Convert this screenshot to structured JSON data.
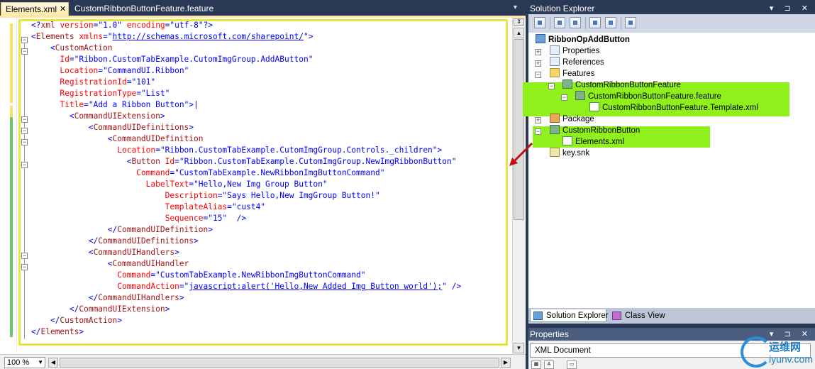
{
  "editor": {
    "tabs": [
      {
        "label": "Elements.xml",
        "close": "✕"
      },
      {
        "label": "CustomRibbonButtonFeature.feature"
      }
    ],
    "tab_menu": "▼",
    "zoom": "100 %",
    "code_lines": [
      [
        [
          "b",
          "<?"
        ],
        [
          "t",
          "xml"
        ],
        [
          "a",
          " version"
        ],
        [
          "b",
          "=\""
        ],
        [
          "v",
          "1.0"
        ],
        [
          "b",
          "\""
        ],
        [
          "a",
          " encoding"
        ],
        [
          "b",
          "=\""
        ],
        [
          "v",
          "utf-8"
        ],
        [
          "b",
          "\"?>"
        ]
      ],
      [
        [
          "b",
          "<"
        ],
        [
          "t",
          "Elements"
        ],
        [
          "a",
          " xmlns"
        ],
        [
          "b",
          "=\""
        ],
        [
          "u",
          "http://schemas.microsoft.com/sharepoint/"
        ],
        [
          "b",
          "\">"
        ]
      ],
      [
        [
          "b",
          "    <"
        ],
        [
          "t",
          "CustomAction"
        ]
      ],
      [
        [
          "a",
          "      Id"
        ],
        [
          "b",
          "=\""
        ],
        [
          "v",
          "Ribbon.CustomTabExample.CutomImgGroup.AddAButton"
        ],
        [
          "b",
          "\""
        ]
      ],
      [
        [
          "a",
          "      Location"
        ],
        [
          "b",
          "=\""
        ],
        [
          "v",
          "CommandUI.Ribbon"
        ],
        [
          "b",
          "\""
        ]
      ],
      [
        [
          "a",
          "      RegistrationId"
        ],
        [
          "b",
          "=\""
        ],
        [
          "v",
          "101"
        ],
        [
          "b",
          "\""
        ]
      ],
      [
        [
          "a",
          "      RegistrationType"
        ],
        [
          "b",
          "=\""
        ],
        [
          "v",
          "List"
        ],
        [
          "b",
          "\""
        ]
      ],
      [
        [
          "a",
          "      Title"
        ],
        [
          "b",
          "=\""
        ],
        [
          "v",
          "Add a Ribbon Button"
        ],
        [
          "b",
          "\">|"
        ]
      ],
      [
        [
          "b",
          "        <"
        ],
        [
          "t",
          "CommandUIExtension"
        ],
        [
          "b",
          ">"
        ]
      ],
      [
        [
          "b",
          "            <"
        ],
        [
          "t",
          "CommandUIDefinitions"
        ],
        [
          "b",
          ">"
        ]
      ],
      [
        [
          "b",
          "                <"
        ],
        [
          "t",
          "CommandUIDefinition"
        ]
      ],
      [
        [
          "a",
          "                  Location"
        ],
        [
          "b",
          "=\""
        ],
        [
          "v",
          "Ribbon.CustomTabExample.CutomImgGroup.Controls._children"
        ],
        [
          "b",
          "\">"
        ]
      ],
      [
        [
          "b",
          "                    <"
        ],
        [
          "t",
          "Button"
        ],
        [
          "a",
          " Id"
        ],
        [
          "b",
          "=\""
        ],
        [
          "v",
          "Ribbon.CustomTabExample.CutomImgGroup.NewImgRibbonButton"
        ],
        [
          "b",
          "\""
        ]
      ],
      [
        [
          "a",
          "                      Command"
        ],
        [
          "b",
          "=\""
        ],
        [
          "v",
          "CustomTabExample.NewRibbonImgButtonCommand"
        ],
        [
          "b",
          "\""
        ]
      ],
      [
        [
          "a",
          "                        LabelText"
        ],
        [
          "b",
          "=\""
        ],
        [
          "v",
          "Hello,New Img Group Button"
        ],
        [
          "b",
          "\""
        ]
      ],
      [
        [
          "a",
          "                            Description"
        ],
        [
          "b",
          "=\""
        ],
        [
          "v",
          "Says Hello,New ImgGroup Button!"
        ],
        [
          "b",
          "\""
        ]
      ],
      [
        [
          "a",
          "                            TemplateAlias"
        ],
        [
          "b",
          "=\""
        ],
        [
          "v",
          "cust4"
        ],
        [
          "b",
          "\""
        ]
      ],
      [
        [
          "a",
          "                            Sequence"
        ],
        [
          "b",
          "=\""
        ],
        [
          "v",
          "15"
        ],
        [
          "b",
          "\"  />"
        ]
      ],
      [
        [
          "b",
          "                </"
        ],
        [
          "t",
          "CommandUIDefinition"
        ],
        [
          "b",
          ">"
        ]
      ],
      [
        [
          "b",
          "            </"
        ],
        [
          "t",
          "CommandUIDefinitions"
        ],
        [
          "b",
          ">"
        ]
      ],
      [
        [
          "b",
          "            <"
        ],
        [
          "t",
          "CommandUIHandlers"
        ],
        [
          "b",
          ">"
        ]
      ],
      [
        [
          "b",
          "                <"
        ],
        [
          "t",
          "CommandUIHandler"
        ]
      ],
      [
        [
          "a",
          "                  Command"
        ],
        [
          "b",
          "=\""
        ],
        [
          "v",
          "CustomTabExample.NewRibbonImgButtonCommand"
        ],
        [
          "b",
          "\""
        ]
      ],
      [
        [
          "a",
          "                  CommandAction"
        ],
        [
          "b",
          "=\""
        ],
        [
          "u",
          "javascript:alert('Hello,New Added Img Button world');"
        ],
        [
          "b",
          "\" />"
        ]
      ],
      [
        [
          "b",
          "            </"
        ],
        [
          "t",
          "CommandUIHandlers"
        ],
        [
          "b",
          ">"
        ]
      ],
      [
        [
          "b",
          "        </"
        ],
        [
          "t",
          "CommandUIExtension"
        ],
        [
          "b",
          ">"
        ]
      ],
      [
        [
          "b",
          "    </"
        ],
        [
          "t",
          "CustomAction"
        ],
        [
          "b",
          ">"
        ]
      ],
      [
        [
          "b",
          "</"
        ],
        [
          "t",
          "Elements"
        ],
        [
          "b",
          ">"
        ]
      ]
    ]
  },
  "solution_explorer": {
    "title": "Solution Explorer",
    "title_buttons": "▾ ⊐ ✕",
    "tree": [
      {
        "label": "RibbonOpAddButton",
        "icon": "project-icon",
        "bold": true
      },
      {
        "label": "Properties",
        "icon": "properties-icon",
        "expander": "+"
      },
      {
        "label": "References",
        "icon": "references-icon",
        "expander": "+"
      },
      {
        "label": "Features",
        "icon": "folder-icon",
        "expander": "−"
      },
      {
        "label": "CustomRibbonButtonFeature",
        "icon": "feature-icon",
        "expander": "−",
        "highlight": true
      },
      {
        "label": "CustomRibbonButtonFeature.feature",
        "icon": "feature-file-icon",
        "expander": "−",
        "highlight": true
      },
      {
        "label": "CustomRibbonButtonFeature.Template.xml",
        "icon": "xml-file-icon",
        "highlight": true
      },
      {
        "label": "Package",
        "icon": "package-icon",
        "expander": "+"
      },
      {
        "label": "CustomRibbonButton",
        "icon": "module-icon",
        "expander": "−",
        "highlight": true
      },
      {
        "label": "Elements.xml",
        "icon": "xml-file-icon",
        "highlight": true
      },
      {
        "label": "key.snk",
        "icon": "key-icon"
      }
    ],
    "tabs": [
      {
        "label": "Solution Explorer"
      },
      {
        "label": "Class View"
      }
    ]
  },
  "properties": {
    "title": "Properties",
    "title_buttons": "▾ ⊐ ✕",
    "selected_object": "XML Document"
  },
  "watermark": {
    "text": "运维网",
    "sub": "iyunv.com"
  },
  "colors": {
    "highlight": "#8ff01b",
    "frame": "#e6e640",
    "ide_background": "#293955"
  }
}
